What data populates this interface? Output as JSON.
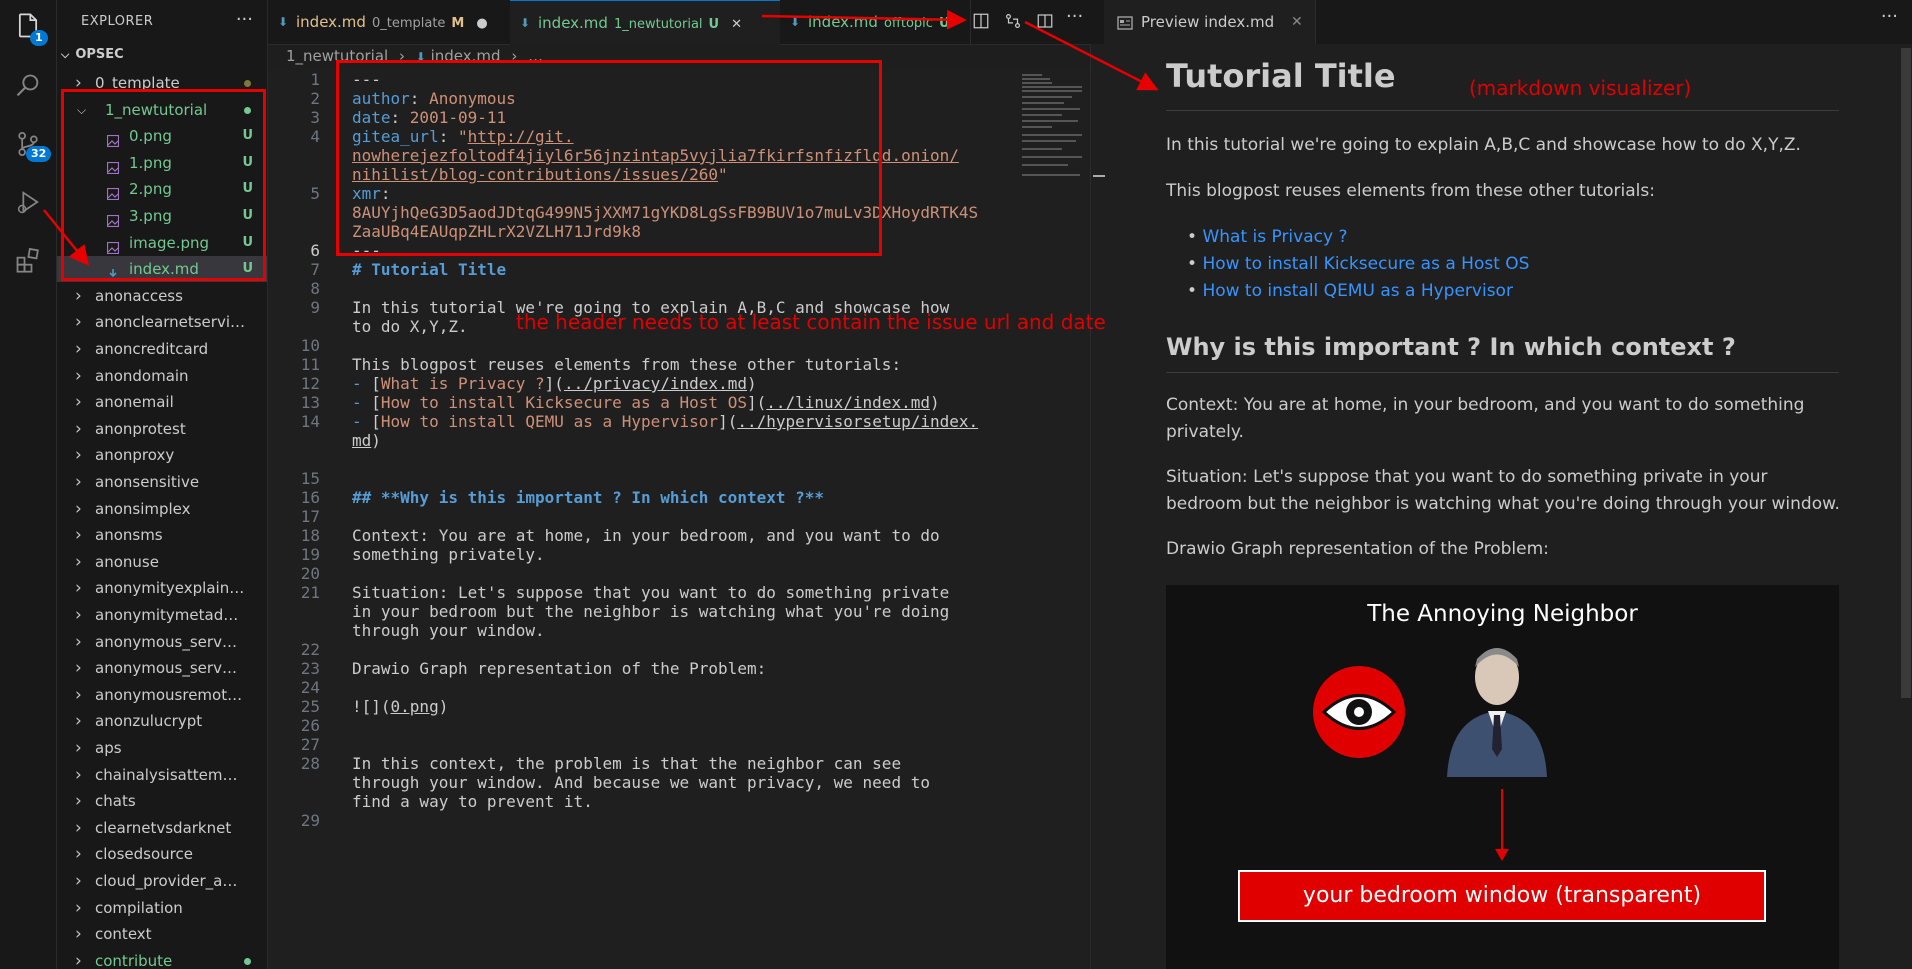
{
  "activity": {
    "explorer_badge": "1",
    "scm_badge": "32"
  },
  "sidebar": {
    "title": "EXPLORER",
    "more": "···",
    "root": "OPSEC",
    "items": [
      {
        "label": "0_template",
        "kind": "folder",
        "color": "#cccccc",
        "status": "",
        "dot": "#7a7a3a"
      },
      {
        "label": "1_newtutorial",
        "kind": "folder-open",
        "color": "#73c991",
        "status": "",
        "dot": "#73c991"
      },
      {
        "label": "0.png",
        "kind": "image",
        "color": "#73c991",
        "status": "U"
      },
      {
        "label": "1.png",
        "kind": "image",
        "color": "#73c991",
        "status": "U"
      },
      {
        "label": "2.png",
        "kind": "image",
        "color": "#73c991",
        "status": "U"
      },
      {
        "label": "3.png",
        "kind": "image",
        "color": "#73c991",
        "status": "U"
      },
      {
        "label": "image.png",
        "kind": "image",
        "color": "#73c991",
        "status": "U"
      },
      {
        "label": "index.md",
        "kind": "md",
        "color": "#73c991",
        "status": "U",
        "selected": true
      },
      {
        "label": "anonaccess",
        "kind": "folder",
        "color": "#cccccc"
      },
      {
        "label": "anonclearnetservices",
        "kind": "folder",
        "color": "#cccccc"
      },
      {
        "label": "anoncreditcard",
        "kind": "folder",
        "color": "#cccccc"
      },
      {
        "label": "anondomain",
        "kind": "folder",
        "color": "#cccccc"
      },
      {
        "label": "anonemail",
        "kind": "folder",
        "color": "#cccccc"
      },
      {
        "label": "anonprotest",
        "kind": "folder",
        "color": "#cccccc"
      },
      {
        "label": "anonproxy",
        "kind": "folder",
        "color": "#cccccc"
      },
      {
        "label": "anonsensitive",
        "kind": "folder",
        "color": "#cccccc"
      },
      {
        "label": "anonsimplex",
        "kind": "folder",
        "color": "#cccccc"
      },
      {
        "label": "anonsms",
        "kind": "folder",
        "color": "#cccccc"
      },
      {
        "label": "anonuse",
        "kind": "folder",
        "color": "#cccccc"
      },
      {
        "label": "anonymityexplained",
        "kind": "folder",
        "color": "#cccccc"
      },
      {
        "label": "anonymitymetadata",
        "kind": "folder",
        "color": "#cccccc"
      },
      {
        "label": "anonymous_server…",
        "kind": "folder",
        "color": "#cccccc"
      },
      {
        "label": "anonymous_server…",
        "kind": "folder",
        "color": "#cccccc"
      },
      {
        "label": "anonymousremote…",
        "kind": "folder",
        "color": "#cccccc"
      },
      {
        "label": "anonzulucrypt",
        "kind": "folder",
        "color": "#cccccc"
      },
      {
        "label": "aps",
        "kind": "folder",
        "color": "#cccccc"
      },
      {
        "label": "chainalysisattempts",
        "kind": "folder",
        "color": "#cccccc"
      },
      {
        "label": "chats",
        "kind": "folder",
        "color": "#cccccc"
      },
      {
        "label": "clearnetvsdarknet",
        "kind": "folder",
        "color": "#cccccc"
      },
      {
        "label": "closedsource",
        "kind": "folder",
        "color": "#cccccc"
      },
      {
        "label": "cloud_provider_adv…",
        "kind": "folder",
        "color": "#cccccc"
      },
      {
        "label": "compilation",
        "kind": "folder",
        "color": "#cccccc"
      },
      {
        "label": "context",
        "kind": "folder",
        "color": "#cccccc"
      },
      {
        "label": "contribute",
        "kind": "folder",
        "color": "#73c991",
        "dot": "#73c991"
      }
    ]
  },
  "tabs": [
    {
      "name": "index.md",
      "sub": "0_template",
      "flag": "M",
      "flag_color": "#e2c08d",
      "name_color": "#e2c08d",
      "sub_color": "#a0a0a0",
      "end": "●"
    },
    {
      "name": "index.md",
      "sub": "1_newtutorial",
      "flag": "U",
      "flag_color": "#73c991",
      "name_color": "#73c991",
      "sub_color": "#73c991",
      "end": "✕",
      "active": true
    },
    {
      "name": "index.md",
      "sub": "offtopic",
      "flag": "U",
      "flag_color": "#73c991",
      "name_color": "#73c991",
      "sub_color": "#73c991",
      "end": ""
    }
  ],
  "breadcrumb": {
    "folder": "1_newtutorial",
    "file": "index.md",
    "rest": "…"
  },
  "editor": {
    "front_dash": "---",
    "author_key": "author",
    "author_val": "Anonymous",
    "date_key": "date",
    "date_val": "2001-09-11",
    "gitea_key": "gitea_url",
    "gitea_url_1": "http://git.",
    "gitea_url_2": "nowherejezfoltodf4jiyl6r56jnzintap5vyjlia7fkirfsnfizflqd.onion/",
    "gitea_url_3": "nihilist/blog-contributions/issues/260",
    "xmr_key": "xmr",
    "xmr_val_1": "8AUYjhQeG3D5aodJDtqG499N5jXXM71gYKD8LgSsFB9BUV1o7muLv3DXHoydRTK4S",
    "xmr_val_2": "ZaaUBq4EAUqpZHLrX2VZLH71Jrd9k8",
    "h1": "# Tutorial Title",
    "p1a": "In this tutorial we're going to explain A,B,C and showcase how",
    "p1b": "to do X,Y,Z.",
    "p2": "This blogpost reuses elements from these other tutorials:",
    "l1_text": "What is Privacy ?",
    "l1_url": "../privacy/index.md",
    "l2_text": "How to install Kicksecure as a Host OS",
    "l2_url": "../linux/index.md",
    "l3_text": "How to install QEMU as a Hypervisor",
    "l3_url1": "../hypervisorsetup/index.",
    "l3_url2": "md",
    "h2": "## **Why is this important ? In which context ?**",
    "c1a": "Context: You are at home, in your bedroom, and you want to do",
    "c1b": "something privately.",
    "s1a": "Situation: Let's suppose that you want to do something private",
    "s1b": "in your bedroom but the neighbor is watching what you're doing",
    "s1c": "through your window.",
    "d1": "Drawio Graph representation of the Problem:",
    "img": "![](0.png)",
    "img_file": "0.png",
    "e1a": "In this context, the problem is that the neighbor can see",
    "e1b": "through your window. And because we want privacy, we need to",
    "e1c": "find a way to prevent it."
  },
  "line_numbers": [
    "1",
    "2",
    "3",
    "4",
    "5",
    "6",
    "7",
    "8",
    "9",
    "10",
    "11",
    "12",
    "13",
    "14",
    "15",
    "16",
    "17",
    "18",
    "19",
    "20",
    "21",
    "22",
    "23",
    "24",
    "25",
    "26",
    "27",
    "28",
    "29"
  ],
  "preview": {
    "tab": "Preview index.md",
    "title": "Tutorial Title",
    "p1": "In this tutorial we're going to explain A,B,C and showcase how to do X,Y,Z.",
    "p2": "This blogpost reuses elements from these other tutorials:",
    "links": [
      "What is Privacy ?",
      "How to install Kicksecure as a Host OS",
      "How to install QEMU as a Hypervisor"
    ],
    "h2": "Why is this important ? In which context ?",
    "c1": "Context: You are at home, in your bedroom, and you want to do something privately.",
    "s1": "Situation: Let's suppose that you want to do something private in your bedroom but the neighbor is watching what you're doing through your window.",
    "d1": "Drawio Graph representation of the Problem:",
    "diagram_title": "The Annoying Neighbor",
    "window_label": "your bedroom window (transparent)"
  },
  "annotations": {
    "header_note": "the header needs to at least contain the issue url and date",
    "visualizer_note": "(markdown visualizer)"
  },
  "colors": {
    "accent": "#0078d4",
    "annotation": "#e60000",
    "git_untracked": "#73c991",
    "git_modified": "#e2c08d"
  }
}
